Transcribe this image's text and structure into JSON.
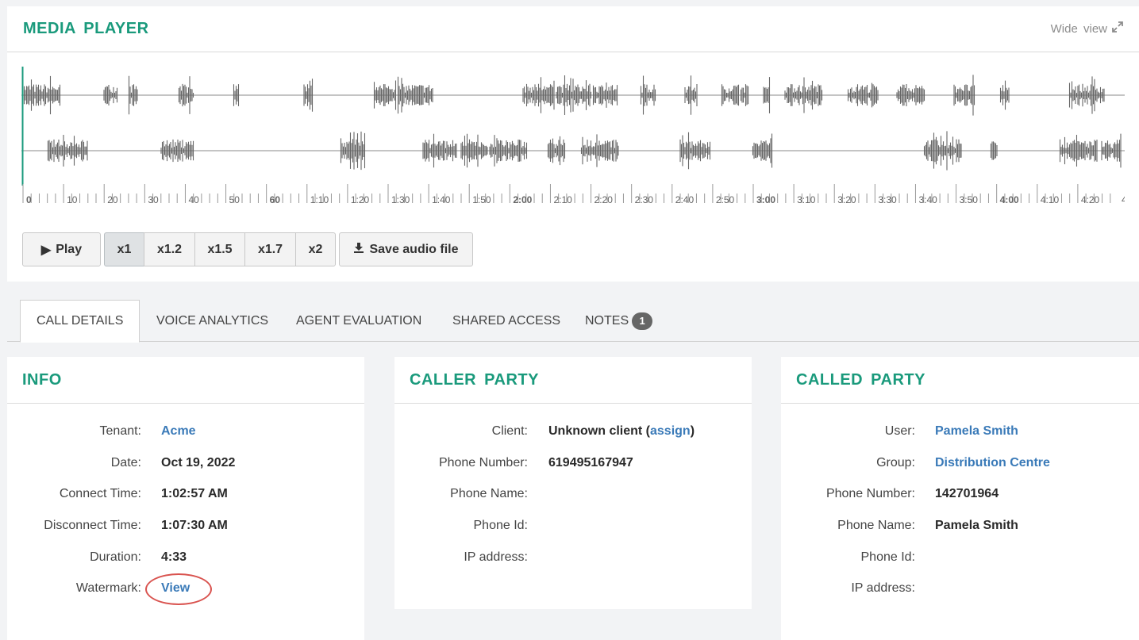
{
  "player": {
    "title": "MEDIA PLAYER",
    "wide_view": "Wide view",
    "timeline_ticks": [
      "0",
      "10",
      "20",
      "30",
      "40",
      "50",
      "60",
      "1:10",
      "1:20",
      "1:30",
      "1:40",
      "1:50",
      "2:00",
      "2:10",
      "2:20",
      "2:30",
      "2:40",
      "2:50",
      "3:00",
      "3:10",
      "3:20",
      "3:30",
      "3:40",
      "3:50",
      "4:00",
      "4:10",
      "4:20",
      "4"
    ],
    "play_label": "Play",
    "speeds": [
      "x1",
      "x1.2",
      "x1.5",
      "x1.7",
      "x2"
    ],
    "selected_speed": "x1",
    "save_label": "Save audio file"
  },
  "tabs": {
    "call_details": "CALL DETAILS",
    "voice_analytics": "VOICE ANALYTICS",
    "agent_evaluation": "AGENT EVALUATION",
    "shared_access": "SHARED ACCESS",
    "notes": "NOTES",
    "notes_count": "1"
  },
  "info": {
    "title": "INFO",
    "tenant_label": "Tenant:",
    "tenant": "Acme",
    "date_label": "Date:",
    "date": "Oct 19, 2022",
    "connect_label": "Connect Time:",
    "connect": "1:02:57 AM",
    "disconnect_label": "Disconnect Time:",
    "disconnect": "1:07:30 AM",
    "duration_label": "Duration:",
    "duration": "4:33",
    "watermark_label": "Watermark:",
    "watermark": "View"
  },
  "caller": {
    "title": "CALLER PARTY",
    "client_label": "Client:",
    "client_prefix": "Unknown client (",
    "client_link": "assign",
    "client_suffix": ")",
    "phone_number_label": "Phone Number:",
    "phone_number": "619495167947",
    "phone_name_label": "Phone Name:",
    "phone_id_label": "Phone Id:",
    "ip_label": "IP address:"
  },
  "called": {
    "title": "CALLED PARTY",
    "user_label": "User:",
    "user": "Pamela Smith",
    "group_label": "Group:",
    "group": "Distribution Centre",
    "phone_number_label": "Phone Number:",
    "phone_number": "142701964",
    "phone_name_label": "Phone Name:",
    "phone_name": "Pamela Smith",
    "phone_id_label": "Phone Id:",
    "ip_label": "IP address:"
  },
  "colors": {
    "accent": "#1a9a7c",
    "link": "#3a7ab8",
    "waveform": "#666666",
    "highlight": "#d9534f"
  }
}
